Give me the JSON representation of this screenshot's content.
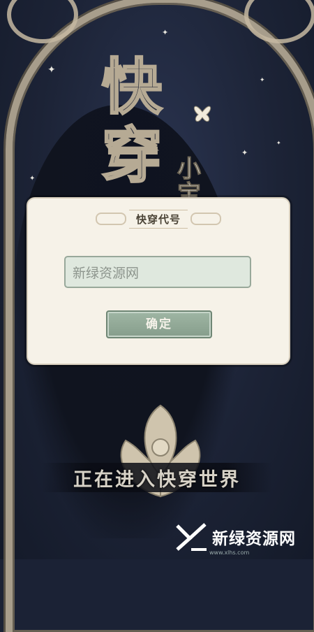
{
  "background": {
    "title_chars": [
      "快",
      "穿"
    ],
    "subtitle_chars": [
      "小",
      "宝"
    ]
  },
  "dialog": {
    "title": "快穿代号",
    "input": {
      "placeholder": "",
      "value": "新绿资源网"
    },
    "confirm_label": "确定"
  },
  "status": {
    "text": "正在进入快穿世界"
  },
  "watermark": {
    "text": "新绿资源网",
    "sub": "www.xlhs.com"
  },
  "colors": {
    "dialog_bg": "#f6f2e8",
    "button_bg": "#92aa97",
    "input_bg": "#dfe8de",
    "arch_gold": "#b7ab95"
  }
}
